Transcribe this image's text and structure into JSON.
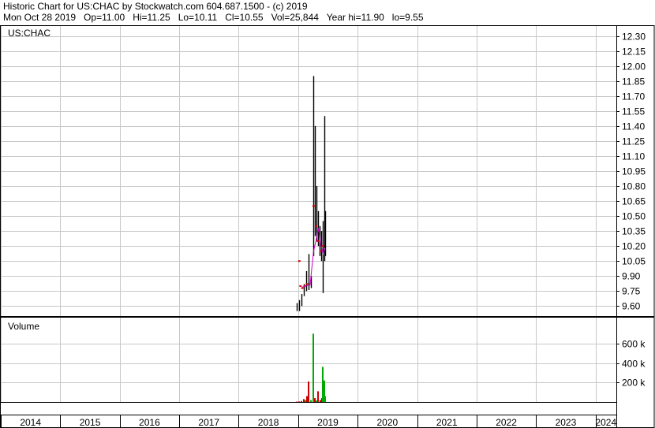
{
  "header": {
    "line1": "Historic Chart for US:CHAC by Stockwatch.com 604.687.1500 - (c) 2019",
    "line2": "Mon Oct 28 2019   Op=11.00   Hi=11.25   Lo=10.11   Cl=10.55   Vol=25,844   Year hi=11.90   lo=9.55"
  },
  "chart_data": {
    "type": "bar",
    "panels": [
      {
        "name": "price",
        "label": "US:CHAC",
        "ylim": [
          9.5,
          12.4
        ],
        "yticks": [
          "12.30",
          "12.15",
          "12.00",
          "11.85",
          "11.70",
          "11.55",
          "11.40",
          "11.25",
          "11.10",
          "10.95",
          "10.80",
          "10.65",
          "10.50",
          "10.35",
          "10.20",
          "10.05",
          "9.90",
          "9.75",
          "9.60"
        ],
        "ohlc_bars": [
          {
            "x": 2018.98,
            "low": 9.55,
            "high": 9.63
          },
          {
            "x": 2019.02,
            "low": 9.55,
            "high": 9.66
          },
          {
            "x": 2019.05,
            "low": 9.6,
            "high": 9.72
          },
          {
            "x": 2019.09,
            "low": 9.7,
            "high": 9.82
          },
          {
            "x": 2019.13,
            "low": 9.75,
            "high": 9.95
          },
          {
            "x": 2019.17,
            "low": 9.76,
            "high": 10.12
          },
          {
            "x": 2019.22,
            "low": 9.78,
            "high": 9.9
          },
          {
            "x": 2019.26,
            "low": 10.1,
            "high": 11.9
          },
          {
            "x": 2019.28,
            "low": 10.3,
            "high": 11.4
          },
          {
            "x": 2019.31,
            "low": 10.25,
            "high": 10.8
          },
          {
            "x": 2019.33,
            "low": 10.2,
            "high": 10.55
          },
          {
            "x": 2019.36,
            "low": 10.1,
            "high": 10.4
          },
          {
            "x": 2019.39,
            "low": 10.05,
            "high": 10.35
          },
          {
            "x": 2019.42,
            "low": 9.73,
            "high": 10.45
          },
          {
            "x": 2019.44,
            "low": 10.05,
            "high": 11.5
          },
          {
            "x": 2019.46,
            "low": 10.1,
            "high": 10.55
          }
        ],
        "red_marks": [
          {
            "x": 2019.02,
            "y": 10.05
          },
          {
            "x": 2019.04,
            "y": 9.8
          },
          {
            "x": 2019.07,
            "y": 9.78
          },
          {
            "x": 2019.11,
            "y": 9.8
          },
          {
            "x": 2019.15,
            "y": 9.82
          },
          {
            "x": 2019.26,
            "y": 10.6
          },
          {
            "x": 2019.3,
            "y": 10.4
          },
          {
            "x": 2019.33,
            "y": 10.25
          },
          {
            "x": 2019.38,
            "y": 10.15
          },
          {
            "x": 2019.42,
            "y": 10.2
          }
        ],
        "moving_average": {
          "color": "#cc00cc",
          "points": [
            {
              "x": 2019.07,
              "y": 9.79
            },
            {
              "x": 2019.13,
              "y": 9.8
            },
            {
              "x": 2019.2,
              "y": 9.81
            },
            {
              "x": 2019.26,
              "y": 10.15
            },
            {
              "x": 2019.3,
              "y": 10.25
            },
            {
              "x": 2019.34,
              "y": 10.38
            },
            {
              "x": 2019.38,
              "y": 10.22
            },
            {
              "x": 2019.42,
              "y": 10.12
            },
            {
              "x": 2019.45,
              "y": 10.18
            }
          ]
        }
      },
      {
        "name": "volume",
        "label": "Volume",
        "ylim": [
          0,
          800
        ],
        "yticks": [
          {
            "value": 600,
            "label": "600 k"
          },
          {
            "value": 400,
            "label": "400 k"
          },
          {
            "value": 200,
            "label": "200 k"
          }
        ],
        "bars": [
          {
            "x": 2018.98,
            "value": 4,
            "color": "#cc0000"
          },
          {
            "x": 2019.02,
            "value": 6,
            "color": "#cc0000"
          },
          {
            "x": 2019.06,
            "value": 10,
            "color": "#cc0000"
          },
          {
            "x": 2019.09,
            "value": 30,
            "color": "#cc0000"
          },
          {
            "x": 2019.12,
            "value": 18,
            "color": "#00aa00"
          },
          {
            "x": 2019.15,
            "value": 60,
            "color": "#cc0000"
          },
          {
            "x": 2019.18,
            "value": 210,
            "color": "#cc0000"
          },
          {
            "x": 2019.21,
            "value": 20,
            "color": "#00aa00"
          },
          {
            "x": 2019.26,
            "value": 700,
            "color": "#00aa00"
          },
          {
            "x": 2019.28,
            "value": 40,
            "color": "#cc0000"
          },
          {
            "x": 2019.31,
            "value": 15,
            "color": "#00aa00"
          },
          {
            "x": 2019.34,
            "value": 110,
            "color": "#cc0000"
          },
          {
            "x": 2019.37,
            "value": 20,
            "color": "#cc0000"
          },
          {
            "x": 2019.4,
            "value": 40,
            "color": "#cc0000"
          },
          {
            "x": 2019.42,
            "value": 360,
            "color": "#00aa00"
          },
          {
            "x": 2019.44,
            "value": 220,
            "color": "#00aa00"
          },
          {
            "x": 2019.46,
            "value": 60,
            "color": "#00aa00"
          }
        ]
      }
    ],
    "x_axis": {
      "xlim": [
        2014,
        2024.35
      ],
      "years": [
        "2014",
        "2015",
        "2016",
        "2017",
        "2018",
        "2019",
        "2020",
        "2021",
        "2022",
        "2023",
        "2024"
      ]
    },
    "grid": true,
    "colors": {
      "ohlc": "#000000",
      "grid": "#c8c8c8",
      "up": "#00aa00",
      "down": "#cc0000"
    }
  }
}
